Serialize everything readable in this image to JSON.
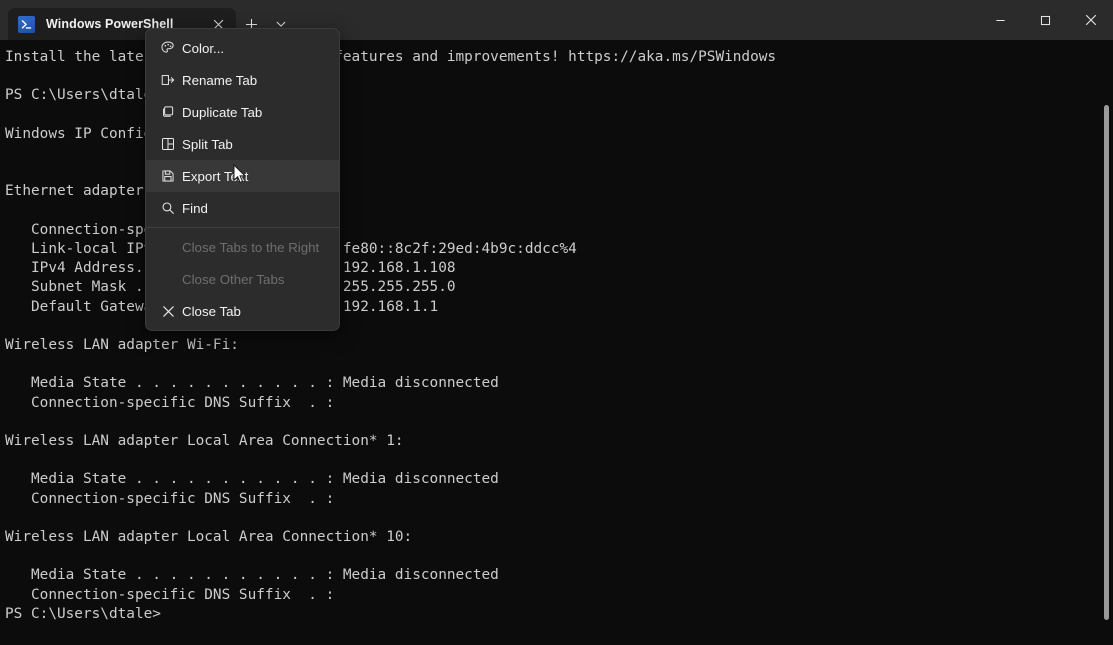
{
  "window": {
    "tab": {
      "title": "Windows PowerShell",
      "icon": "powershell-icon",
      "close_label": "✕"
    },
    "new_tab_label": "+",
    "tab_dropdown_label": "⌄",
    "controls": {
      "minimize": "–",
      "maximize": "□",
      "close": "✕"
    }
  },
  "context_menu": {
    "items": [
      {
        "label": "Color...",
        "icon": "palette-icon",
        "enabled": true,
        "highlighted": false
      },
      {
        "label": "Rename Tab",
        "icon": "rename-icon",
        "enabled": true,
        "highlighted": false
      },
      {
        "label": "Duplicate Tab",
        "icon": "duplicate-icon",
        "enabled": true,
        "highlighted": false
      },
      {
        "label": "Split Tab",
        "icon": "split-icon",
        "enabled": true,
        "highlighted": false
      },
      {
        "label": "Export Text",
        "icon": "save-icon",
        "enabled": true,
        "highlighted": true
      },
      {
        "label": "Find",
        "icon": "search-icon",
        "enabled": true,
        "highlighted": false
      },
      {
        "label": "Close Tabs to the Right",
        "icon": "none",
        "enabled": false,
        "highlighted": false
      },
      {
        "label": "Close Other Tabs",
        "icon": "none",
        "enabled": false,
        "highlighted": false
      },
      {
        "label": "Close Tab",
        "icon": "close-icon",
        "enabled": true,
        "highlighted": false
      }
    ]
  },
  "terminal": {
    "content": "Install the latest PowerShell for new features and improvements! https://aka.ms/PSWindows\n\nPS C:\\Users\\dtale> ipconfig\n\nWindows IP Configuration\n\n\nEthernet adapter Ethernet:\n\n   Connection-specific DNS Suffix  . :\n   Link-local IPv6 Address . . . . . : fe80::8c2f:29ed:4b9c:ddcc%4\n   IPv4 Address. . . . . . . . . . . : 192.168.1.108\n   Subnet Mask . . . . . . . . . . . : 255.255.255.0\n   Default Gateway . . . . . . . . . : 192.168.1.1\n\nWireless LAN adapter Wi-Fi:\n\n   Media State . . . . . . . . . . . : Media disconnected\n   Connection-specific DNS Suffix  . :\n\nWireless LAN adapter Local Area Connection* 1:\n\n   Media State . . . . . . . . . . . : Media disconnected\n   Connection-specific DNS Suffix  . :\n\nWireless LAN adapter Local Area Connection* 10:\n\n   Media State . . . . . . . . . . . : Media disconnected\n   Connection-specific DNS Suffix  . :\nPS C:\\Users\\dtale>"
  },
  "colors": {
    "terminal_background": "#0c0c0c",
    "terminal_text": "#cccccc",
    "titlebar_background": "#2b2b2b",
    "tab_background": "#1e1e1e",
    "menu_background": "#2c2c2c",
    "menu_highlight": "#383838",
    "menu_disabled_text": "#6e6e6e",
    "accent_blue": "#2f6fd0"
  }
}
